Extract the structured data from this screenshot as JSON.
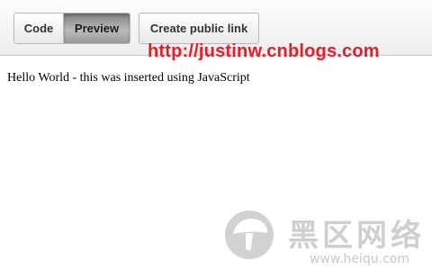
{
  "toolbar": {
    "code_label": "Code",
    "preview_label": "Preview",
    "public_link_label": "Create public link"
  },
  "watermark": {
    "url_text": "http://justinw.cnblogs.com"
  },
  "preview": {
    "output_text": "Hello World - this was inserted using JavaScript"
  },
  "site_logo": {
    "chinese_text": "黑区网络",
    "domain_text": "www.heiqu.com",
    "icon": "mushroom-logo-icon"
  },
  "colors": {
    "watermark_red": "#e0212d",
    "active_tab_gray": "#9a9a9a",
    "logo_gray": "#cfcfcf"
  }
}
